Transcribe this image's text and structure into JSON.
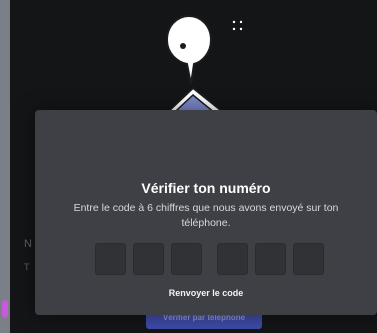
{
  "background": {
    "heading_fragment": "N",
    "small_fragment": "T",
    "button_label": "Vérifier par téléphone"
  },
  "modal": {
    "title": "Vérifier ton numéro",
    "subtitle": "Entre le code à 6 chiffres que nous avons envoyé sur ton téléphone.",
    "code_length": 6,
    "code_values": [
      "",
      "",
      "",
      "",
      "",
      ""
    ],
    "resend_label": "Renvoyer le code"
  },
  "colors": {
    "modal_bg": "#3e4045",
    "input_bg": "#303236",
    "phone_screen": "#7c88c9",
    "brand_button": "#3f4aa6"
  },
  "icons": [
    "speech-bubble-icon",
    "phone-illustration-icon",
    "sparkle-dots-icon"
  ]
}
